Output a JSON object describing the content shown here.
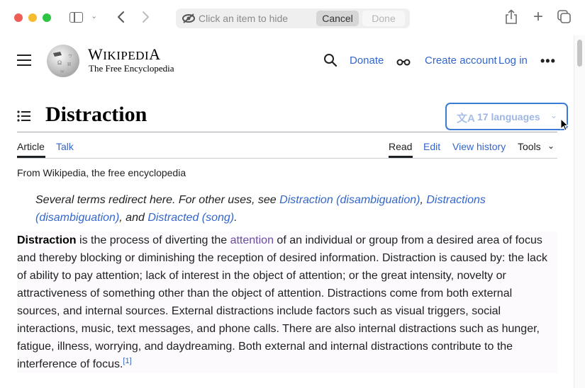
{
  "browser": {
    "hide_prompt": "Click an item to hide",
    "cancel_label": "Cancel",
    "done_label": "Done",
    "icons": [
      "sidebar-icon",
      "chevron-down-icon",
      "back-icon",
      "forward-icon",
      "eye-slash-icon",
      "share-icon",
      "new-tab-icon",
      "tabs-overview-icon"
    ]
  },
  "header": {
    "wordmark_first": "W",
    "wordmark_rest": "IKIPEDI",
    "wordmark_last": "A",
    "tagline": "The Free Encyclopedia",
    "donate": "Donate",
    "create_account": "Create account",
    "log_in": "Log in",
    "more": "•••"
  },
  "page": {
    "title": "Distraction",
    "languages": "17 languages",
    "tabs_left": [
      "Article",
      "Talk"
    ],
    "tabs_right": [
      "Read",
      "Edit",
      "View history",
      "Tools"
    ],
    "from": "From Wikipedia, the free encyclopedia",
    "hatnote": {
      "prefix": "Several terms redirect here. For other uses, see ",
      "link1": "Distraction (disambiguation)",
      "sep1": ", ",
      "link2": "Distractions (disambiguation)",
      "sep2": ", and ",
      "link3": "Distracted (song)",
      "suffix": "."
    },
    "paragraph": {
      "bold": "Distraction",
      "part1": " is the process of diverting the ",
      "link": "attention",
      "part2": " of an individual or group from a desired area of focus and thereby blocking or diminishing the reception of desired information. Distraction is caused by: the lack of ability to pay attention; lack of interest in the object of attention; or the great intensity, novelty or attractiveness of something other than the object of attention. Distractions come from both external sources, and internal sources. External distractions include factors such as visual triggers, social interactions, music, text messages, and phone calls. There are also internal distractions such as hunger, fatigue, illness, worrying, and daydreaming. Both external and internal distractions contribute to the interference of focus.",
      "ref": "[1]"
    }
  }
}
